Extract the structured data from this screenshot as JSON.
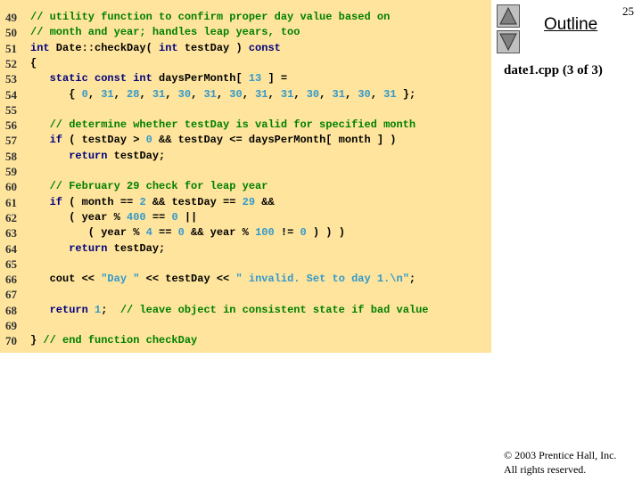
{
  "slide_number": "25",
  "outline_label": "Outline",
  "file_label": "date1.cpp (3 of 3)",
  "copyright": "© 2003 Prentice Hall, Inc.",
  "rights": "All rights reserved.",
  "nav": {
    "up": "up-arrow",
    "down": "down-arrow"
  },
  "colors": {
    "panel": "#fee49c",
    "comment": "#008000",
    "keyword": "#000080",
    "literal": "#3399cc"
  },
  "lines": [
    {
      "num": "49",
      "tokens": [
        [
          "c",
          "// utility function to confirm proper day value based on"
        ]
      ]
    },
    {
      "num": "50",
      "tokens": [
        [
          "c",
          "// month and year; handles leap years, too"
        ]
      ]
    },
    {
      "num": "51",
      "tokens": [
        [
          "k",
          "int"
        ],
        [
          "t",
          " Date::checkDay( "
        ],
        [
          "k",
          "int"
        ],
        [
          "t",
          " testDay ) "
        ],
        [
          "k",
          "const"
        ]
      ]
    },
    {
      "num": "52",
      "tokens": [
        [
          "t",
          "{"
        ]
      ]
    },
    {
      "num": "53",
      "tokens": [
        [
          "t",
          "   "
        ],
        [
          "k",
          "static const int"
        ],
        [
          "t",
          " daysPerMonth[ "
        ],
        [
          "n",
          "13"
        ],
        [
          "t",
          " ] ="
        ]
      ]
    },
    {
      "num": "54",
      "tokens": [
        [
          "t",
          "      { "
        ],
        [
          "n",
          "0"
        ],
        [
          "t",
          ", "
        ],
        [
          "n",
          "31"
        ],
        [
          "t",
          ", "
        ],
        [
          "n",
          "28"
        ],
        [
          "t",
          ", "
        ],
        [
          "n",
          "31"
        ],
        [
          "t",
          ", "
        ],
        [
          "n",
          "30"
        ],
        [
          "t",
          ", "
        ],
        [
          "n",
          "31"
        ],
        [
          "t",
          ", "
        ],
        [
          "n",
          "30"
        ],
        [
          "t",
          ", "
        ],
        [
          "n",
          "31"
        ],
        [
          "t",
          ", "
        ],
        [
          "n",
          "31"
        ],
        [
          "t",
          ", "
        ],
        [
          "n",
          "30"
        ],
        [
          "t",
          ", "
        ],
        [
          "n",
          "31"
        ],
        [
          "t",
          ", "
        ],
        [
          "n",
          "30"
        ],
        [
          "t",
          ", "
        ],
        [
          "n",
          "31"
        ],
        [
          "t",
          " };"
        ]
      ]
    },
    {
      "num": "55",
      "tokens": []
    },
    {
      "num": "56",
      "tokens": [
        [
          "t",
          "   "
        ],
        [
          "c",
          "// determine whether testDay is valid for specified month"
        ]
      ]
    },
    {
      "num": "57",
      "tokens": [
        [
          "t",
          "   "
        ],
        [
          "k",
          "if"
        ],
        [
          "t",
          " ( testDay > "
        ],
        [
          "n",
          "0"
        ],
        [
          "t",
          " && testDay <= daysPerMonth[ month ] )"
        ]
      ]
    },
    {
      "num": "58",
      "tokens": [
        [
          "t",
          "      "
        ],
        [
          "k",
          "return"
        ],
        [
          "t",
          " testDay;"
        ]
      ]
    },
    {
      "num": "59",
      "tokens": []
    },
    {
      "num": "60",
      "tokens": [
        [
          "t",
          "   "
        ],
        [
          "c",
          "// February 29 check for leap year"
        ]
      ]
    },
    {
      "num": "61",
      "tokens": [
        [
          "t",
          "   "
        ],
        [
          "k",
          "if"
        ],
        [
          "t",
          " ( month == "
        ],
        [
          "n",
          "2"
        ],
        [
          "t",
          " && testDay == "
        ],
        [
          "n",
          "29"
        ],
        [
          "t",
          " &&"
        ]
      ]
    },
    {
      "num": "62",
      "tokens": [
        [
          "t",
          "      ( year % "
        ],
        [
          "n",
          "400"
        ],
        [
          "t",
          " == "
        ],
        [
          "n",
          "0"
        ],
        [
          "t",
          " ||"
        ]
      ]
    },
    {
      "num": "63",
      "tokens": [
        [
          "t",
          "         ( year % "
        ],
        [
          "n",
          "4"
        ],
        [
          "t",
          " == "
        ],
        [
          "n",
          "0"
        ],
        [
          "t",
          " && year % "
        ],
        [
          "n",
          "100"
        ],
        [
          "t",
          " != "
        ],
        [
          "n",
          "0"
        ],
        [
          "t",
          " ) ) )"
        ]
      ]
    },
    {
      "num": "64",
      "tokens": [
        [
          "t",
          "      "
        ],
        [
          "k",
          "return"
        ],
        [
          "t",
          " testDay;"
        ]
      ]
    },
    {
      "num": "65",
      "tokens": []
    },
    {
      "num": "66",
      "tokens": [
        [
          "t",
          "   cout << "
        ],
        [
          "s",
          "\"Day \""
        ],
        [
          "t",
          " << testDay << "
        ],
        [
          "s",
          "\" invalid. Set to day 1.\\n\""
        ],
        [
          "t",
          ";"
        ]
      ]
    },
    {
      "num": "67",
      "tokens": []
    },
    {
      "num": "68",
      "tokens": [
        [
          "t",
          "   "
        ],
        [
          "k",
          "return"
        ],
        [
          "t",
          " "
        ],
        [
          "n",
          "1"
        ],
        [
          "t",
          ";  "
        ],
        [
          "c",
          "// leave object in consistent state if bad value"
        ]
      ]
    },
    {
      "num": "69",
      "tokens": []
    },
    {
      "num": "70",
      "tokens": [
        [
          "t",
          "} "
        ],
        [
          "c",
          "// end function checkDay"
        ]
      ]
    }
  ]
}
